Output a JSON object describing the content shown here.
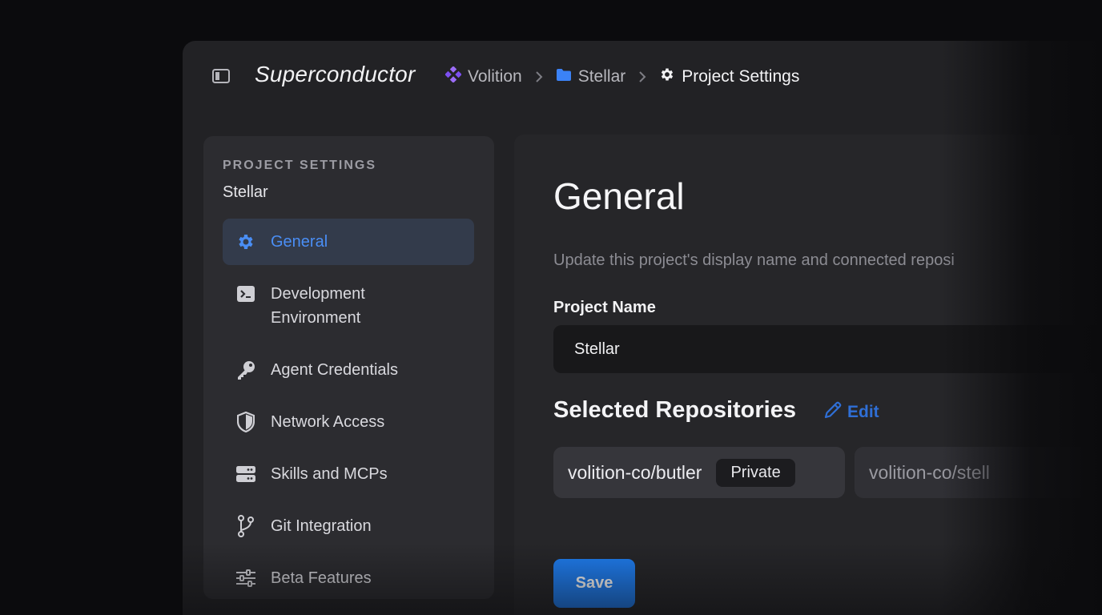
{
  "app": {
    "title": "Superconductor"
  },
  "breadcrumb": [
    {
      "label": "Volition",
      "icon": "diamond-grid-icon"
    },
    {
      "label": "Stellar",
      "icon": "folder-icon"
    },
    {
      "label": "Project Settings",
      "icon": "gear-icon"
    }
  ],
  "sidebar": {
    "heading": "PROJECT SETTINGS",
    "project": "Stellar",
    "items": [
      {
        "label": "General",
        "icon": "gear-icon",
        "active": true
      },
      {
        "label": "Development Environment",
        "icon": "terminal-icon"
      },
      {
        "label": "Agent Credentials",
        "icon": "key-icon"
      },
      {
        "label": "Network Access",
        "icon": "shield-icon"
      },
      {
        "label": "Skills and MCPs",
        "icon": "server-icon"
      },
      {
        "label": "Git Integration",
        "icon": "git-branch-icon"
      },
      {
        "label": "Beta Features",
        "icon": "sliders-icon"
      }
    ]
  },
  "main": {
    "title": "General",
    "description": "Update this project's display name and connected reposi",
    "project_name_label": "Project Name",
    "project_name_value": "Stellar",
    "repos_heading": "Selected Repositories",
    "edit_label": "Edit",
    "repos": [
      {
        "name": "volition-co/butler",
        "badge": "Private"
      },
      {
        "name": "volition-co/stell"
      }
    ],
    "save_label": "Save"
  },
  "colors": {
    "accent": "#1f7ef2",
    "active_text": "#4a8ef5",
    "brand_purple": "#8b5cf6",
    "folder_blue": "#3b82f6"
  }
}
